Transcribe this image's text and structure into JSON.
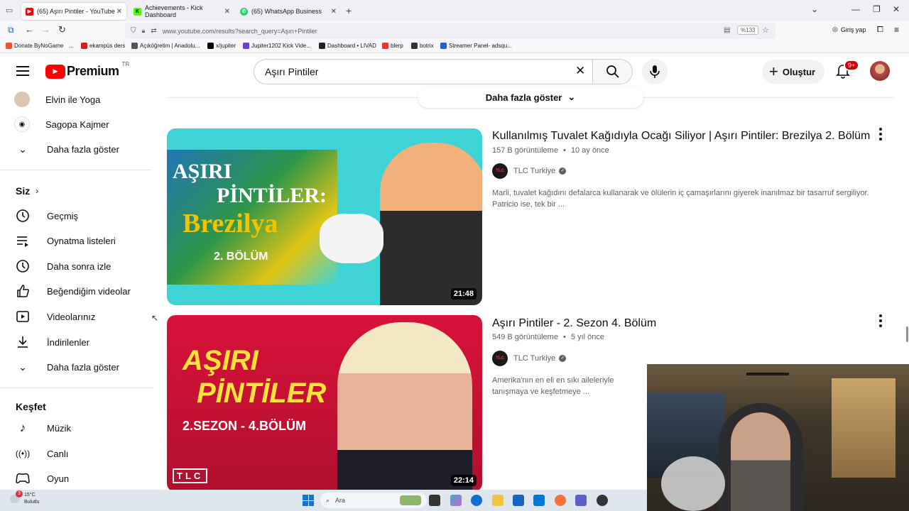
{
  "browser": {
    "tabs": [
      {
        "label": "(65) Aşırı Pintiler - YouTube",
        "color": "#ff0000"
      },
      {
        "label": "Achievements - Kick Dashboard",
        "color": "#53fc18"
      },
      {
        "label": "(65) WhatsApp Business",
        "color": "#25d366"
      }
    ],
    "new_tab": "+",
    "url": "www.youtube.com/results?search_query=Aşırı+Pintiler",
    "zoom": "%133",
    "sign_in": "Giriş yap",
    "bookmarks": [
      "Donate ByNoGame",
      "...",
      "ekampüs ders",
      "Açıköğretim | Anadolu...",
      "x/jupiter",
      "Jupiter1202 Kick Vide...",
      "Dashboard • LIVAD",
      "blerp",
      "botrix",
      "Streamer Panel- adsqu..."
    ]
  },
  "header": {
    "logo": "Premium",
    "region": "TR",
    "search_query": "Aşırı Pintiler",
    "create_label": "Oluştur",
    "notif_badge": "9+"
  },
  "sidebar": {
    "top_items": [
      {
        "label": "Elvin ile Yoga"
      },
      {
        "label": "Sagopa Kajmer"
      },
      {
        "label": "Daha fazla göster"
      }
    ],
    "you_heading": "Siz",
    "you_items": [
      {
        "label": "Geçmiş",
        "icon": "history-icon"
      },
      {
        "label": "Oynatma listeleri",
        "icon": "playlist-icon"
      },
      {
        "label": "Daha sonra izle",
        "icon": "clock-icon"
      },
      {
        "label": "Beğendiğim videolar",
        "icon": "thumbs-up-icon"
      },
      {
        "label": "Videolarınız",
        "icon": "video-icon"
      },
      {
        "label": "İndirilenler",
        "icon": "download-icon"
      },
      {
        "label": "Daha fazla göster",
        "icon": "chevron-down-icon"
      }
    ],
    "explore_heading": "Keşfet",
    "explore_items": [
      {
        "label": "Müzik",
        "icon": "music-icon"
      },
      {
        "label": "Canlı",
        "icon": "live-icon"
      },
      {
        "label": "Oyun",
        "icon": "gamepad-icon"
      }
    ]
  },
  "results": {
    "more_label": "Daha fazla göster",
    "videos": [
      {
        "title": "Kullanılmış Tuvalet Kağıdıyla Ocağı Siliyor | Aşırı Pintiler: Brezilya 2. Bölüm",
        "views": "157 B görüntüleme",
        "age": "10 ay önce",
        "channel": "TLC Turkiye",
        "description": "Marli, tuvalet kağıdını defalarca kullanarak ve ölülerin iç çamaşırlarını giyerek inanılmaz bir tasarruf sergiliyor. Patricio ise, tek bir ...",
        "duration": "21:48",
        "thumb_text": [
          "AŞIRI",
          "PİNTİLER:",
          "Brezilya",
          "2. BÖLÜM"
        ]
      },
      {
        "title": "Aşırı Pintiler - 2. Sezon 4. Bölüm",
        "views": "549 B görüntüleme",
        "age": "5 yıl önce",
        "channel": "TLC Turkiye",
        "description": "Amerika'nın en eli en sıkı aileleriyle tanışmaya ve keşfetmeye ...",
        "duration": "22:14",
        "thumb_text": [
          "AŞIRI",
          "PİNTİLER",
          "2.SEZON - 4.BÖLÜM",
          "TLC"
        ]
      }
    ]
  },
  "taskbar": {
    "weather_temp": "15°C",
    "weather_desc": "Bulutlu",
    "weather_badge": "3",
    "search_label": "Ara"
  }
}
